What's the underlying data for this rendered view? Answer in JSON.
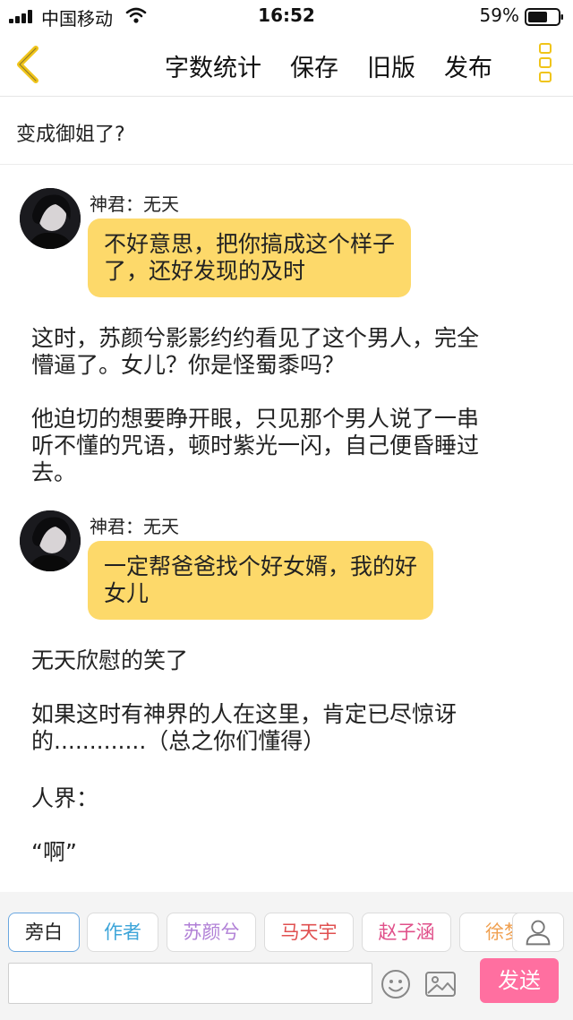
{
  "status": {
    "carrier": "中国移动",
    "time": "16:52",
    "battery": "59%"
  },
  "nav": {
    "word_count": "字数统计",
    "save": "保存",
    "old_version": "旧版",
    "publish": "发布"
  },
  "chapter_title": "变成御姐了?",
  "messages": [
    {
      "speaker": "神君：无天",
      "line1": "不好意思，把你搞成这个样子",
      "line2": "了，还好发现的及时"
    },
    {
      "speaker": "神君：无天",
      "line1": "一定帮爸爸找个好女婿，我的好",
      "line2": "女儿"
    }
  ],
  "narration": {
    "p1_line1": "这时，苏颜兮影影约约看见了这个男人，完全",
    "p1_line2": "懵逼了。女儿？你是怪蜀黍吗？",
    "p2_line1": "他迫切的想要睁开眼，只见那个男人说了一串",
    "p2_line2": "听不懂的咒语，顿时紫光一闪，自己便昏睡过",
    "p2_line3": "去。",
    "p3": "无天欣慰的笑了",
    "p4_line1": "如果这时有神界的人在这里，肯定已尽惊讶",
    "p4_line2": "的.............（总之你们懂得）",
    "p5": "人界：",
    "p6": "“啊”"
  },
  "roles": [
    "旁白",
    "作者",
    "苏颜兮",
    "马天宇",
    "赵子涵",
    "徐梦"
  ],
  "composer": {
    "send": "发送",
    "placeholder": ""
  },
  "colors": {
    "bubble": "#fdd96a",
    "send": "#ff6fa0",
    "accent": "#f0c419"
  },
  "icons": [
    "back-chevron-icon",
    "more-menu-icon",
    "emoji-icon",
    "image-icon",
    "user-icon"
  ]
}
